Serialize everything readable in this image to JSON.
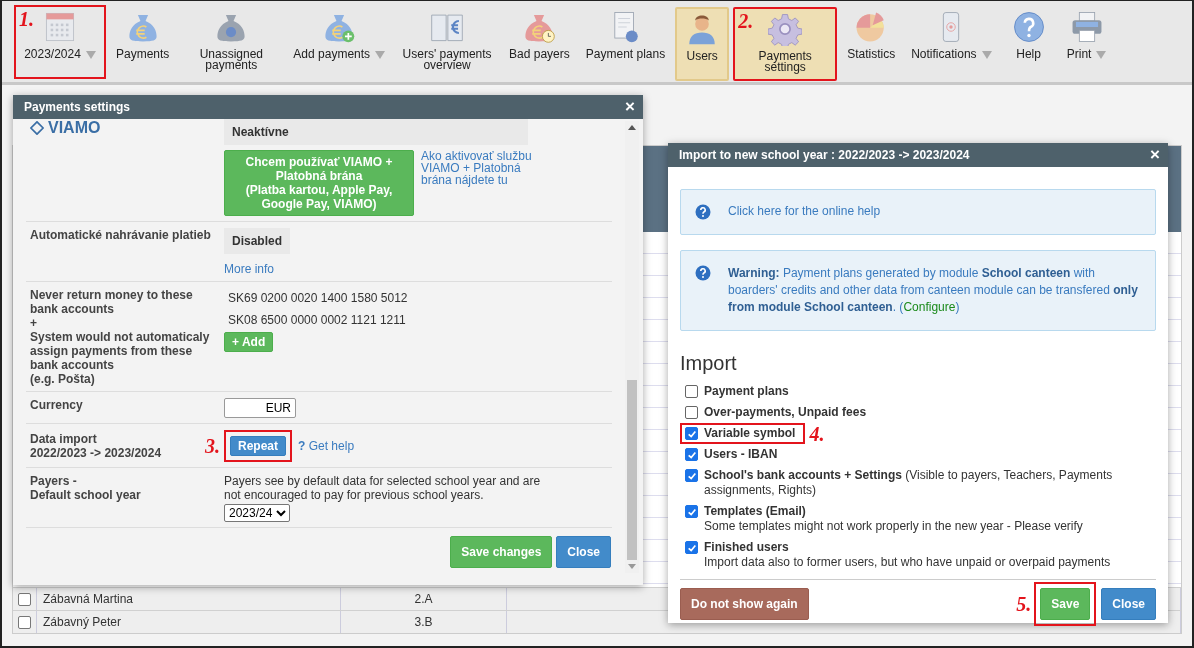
{
  "toolbar": [
    {
      "label": "2023/2024",
      "kind": "calendar",
      "selected": false,
      "has_menu": true,
      "highlighted": true,
      "callout": "1."
    },
    {
      "label": "Payments",
      "kind": "bag",
      "selected": false,
      "has_menu": false,
      "highlighted": false
    },
    {
      "label": "Unassigned payments",
      "kind": "bag-question",
      "selected": false,
      "has_menu": false,
      "highlighted": false
    },
    {
      "label": "Add payments",
      "kind": "bag-plus",
      "selected": false,
      "has_menu": true,
      "highlighted": false
    },
    {
      "label": "Users' payments overview",
      "kind": "book",
      "selected": false,
      "has_menu": false,
      "highlighted": false
    },
    {
      "label": "Bad payers",
      "kind": "bag-clock",
      "selected": false,
      "has_menu": false,
      "highlighted": false
    },
    {
      "label": "Payment plans",
      "kind": "document",
      "selected": false,
      "has_menu": false,
      "highlighted": false
    },
    {
      "label": "Users",
      "kind": "user",
      "selected": true,
      "has_menu": false,
      "highlighted": false
    },
    {
      "label": "Payments settings",
      "kind": "gear",
      "selected": true,
      "has_menu": false,
      "highlighted": true,
      "callout": "2."
    },
    {
      "label": "Statistics",
      "kind": "pie",
      "selected": false,
      "has_menu": false,
      "highlighted": false
    },
    {
      "label": "Notifications",
      "kind": "phone",
      "selected": false,
      "has_menu": true,
      "highlighted": false
    },
    {
      "label": "Help",
      "kind": "help",
      "selected": false,
      "has_menu": false,
      "highlighted": false
    },
    {
      "label": "Print",
      "kind": "printer",
      "selected": false,
      "has_menu": true,
      "highlighted": false
    }
  ],
  "background_table": {
    "rows": [
      {
        "checked": false,
        "name": "Zábavná Martina",
        "class": "2.A"
      },
      {
        "checked": false,
        "name": "Zábavný Peter",
        "class": "3.B"
      }
    ]
  },
  "settings_dialog": {
    "title": "Payments settings",
    "close": "×",
    "viamo": {
      "logo": "VIAMO",
      "status": "Neaktívne",
      "activate_button": [
        "Chcem používať VIAMO +",
        "Platobná brána",
        "(Platba kartou, Apple Pay,",
        "Google Pay, VIAMO)"
      ],
      "help_link": "Ako aktivovať službu VIAMO + Platobná brána nájdete tu"
    },
    "auto_upload": {
      "label": "Automatické nahrávanie platieb",
      "status": "Disabled",
      "link": "More info"
    },
    "bank_accounts": {
      "label": [
        "Never return money to these bank accounts",
        "+",
        "System would not automaticaly assign payments from these bank accounts",
        "(e.g. Pošta)"
      ],
      "accounts": [
        "SK69 0200 0020 1400 1580 5012",
        "SK08 6500 0000 0002 1121 1211"
      ],
      "add_button": "+ Add"
    },
    "currency": {
      "label": "Currency",
      "value": "EUR"
    },
    "data_import": {
      "label": [
        "Data import",
        "2022/2023 -> 2023/2024"
      ],
      "button": "Repeat",
      "highlighted": true,
      "callout": "3.",
      "help_mark": "?",
      "help_link": "Get help"
    },
    "default_year": {
      "label": [
        "Payers -",
        "Default school year"
      ],
      "description": "Payers see by default data for selected school year and are not encouraged to pay for previous school years.",
      "value": "2023/24"
    },
    "buttons": [
      {
        "label": "Save changes",
        "kind": "success"
      },
      {
        "label": "Close",
        "kind": "primary"
      }
    ]
  },
  "import_dialog": {
    "title": "Import to new school year : 2022/2023 -> 2023/2024",
    "close": "×",
    "help_link": "Click here for the online help",
    "warning": {
      "text": "**Warning:** Payment plans generated by module **School canteen** with boarders' credits and other data from canteen module can be transfered **only from module School canteen**. (",
      "link": "Configure",
      "text_after": ")"
    },
    "heading": "Import",
    "options": [
      {
        "label": "Payment plans",
        "kind": "plain",
        "checked": false,
        "highlighted": false
      },
      {
        "label": "Over-payments, Unpaid fees",
        "kind": "plain",
        "checked": false,
        "highlighted": false
      },
      {
        "label": "Variable symbol",
        "kind": "plain",
        "checked": true,
        "highlighted": true,
        "callout": "4."
      },
      {
        "label": "Users - IBAN",
        "kind": "plain",
        "checked": true,
        "highlighted": false
      },
      {
        "label": "School's bank accounts + Settings",
        "note": "(Visible to payers, Teachers, Payments assignments, Rights)",
        "kind": "inline-note",
        "checked": true,
        "highlighted": false
      },
      {
        "label": "Templates (Email)",
        "note": "Some templates might not work properly in the new year - Please verify",
        "kind": "note-below",
        "checked": true,
        "highlighted": false
      },
      {
        "label": "Finished users",
        "note": "Import data also to former users, but who have unpaid or overpaid payments",
        "kind": "note-below",
        "checked": true,
        "highlighted": false
      }
    ],
    "dismiss_button": "Do not show again",
    "save": {
      "label": "Save",
      "highlighted": true,
      "callout": "5."
    },
    "close_button": "Close"
  }
}
